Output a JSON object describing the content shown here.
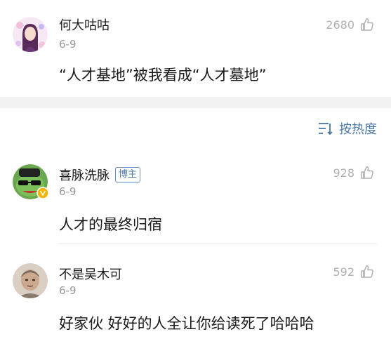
{
  "comments": [
    {
      "name": "何大咕咕",
      "date": "6-9",
      "likes": "2680",
      "text": "“人才基地”被我看成“人才墓地”"
    },
    {
      "name": "喜脉洗脉",
      "badge": "博主",
      "date": "6-9",
      "likes": "928",
      "text": "人才的最终归宿"
    },
    {
      "name": "不是吴木可",
      "date": "6-9",
      "likes": "592",
      "text": "好家伙 好好的人全让你给读死了哈哈哈"
    }
  ],
  "sort": {
    "label": "按热度",
    "icon": "sort-icon"
  },
  "colors": {
    "link_blue": "#4a77a8",
    "muted": "#9a9a9a",
    "separator": "#f2f2f2"
  }
}
